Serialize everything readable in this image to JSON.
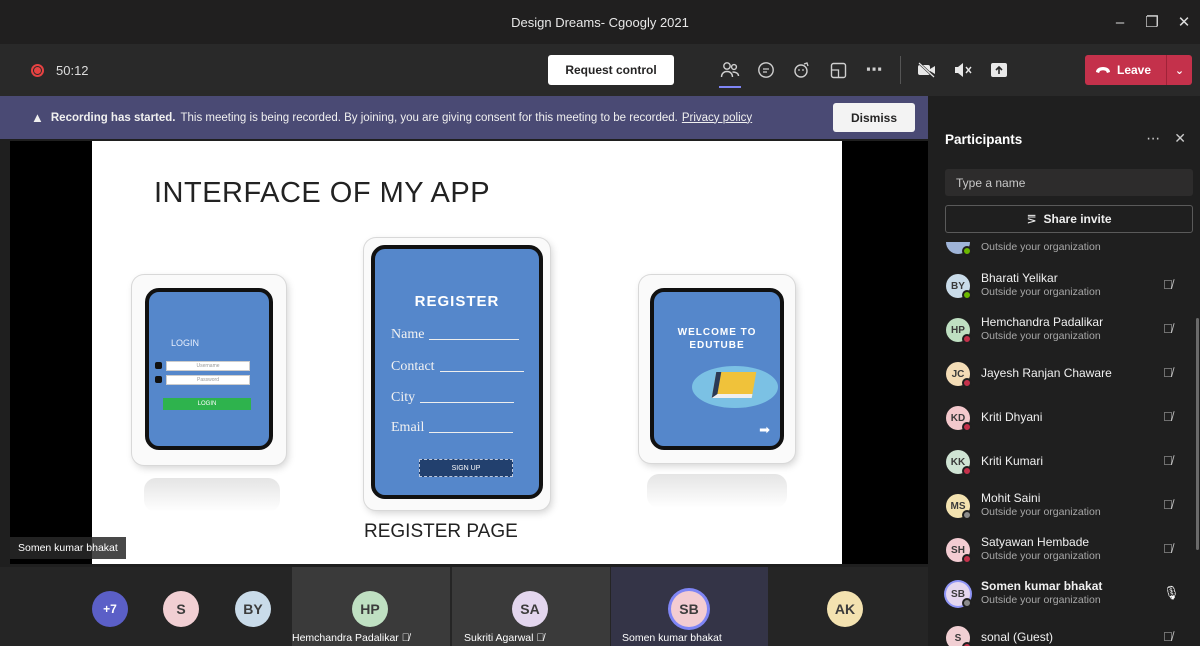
{
  "window": {
    "title": "Design Dreams- Cgoogly 2021"
  },
  "toolbar": {
    "timer": "50:12",
    "request_control": "Request control",
    "leave_label": "Leave"
  },
  "banner": {
    "bold": "Recording has started.",
    "text": "This meeting is being recorded. By joining, you are giving consent for this meeting to be recorded.",
    "link": "Privacy policy",
    "dismiss": "Dismiss"
  },
  "slide": {
    "title": "INTERFACE  OF MY APP",
    "login_title": "LOGIN",
    "username_ph": "Username",
    "password_ph": "Password",
    "login_button": "LOGIN",
    "register_title": "REGISTER",
    "fields": [
      "Name",
      "Contact",
      "City",
      "Email"
    ],
    "signup_button": "SIGN UP",
    "welcome_line1": "WELCOME TO",
    "welcome_line2": "EDUTUBE",
    "register_caption": "REGISTER PAGE"
  },
  "presenter_name": "Somen kumar bhakat",
  "participants_panel": {
    "title": "Participants",
    "search_placeholder": "Type a name",
    "share_invite": "Share invite",
    "list": [
      {
        "initials": "",
        "name": "",
        "org": "Outside your organization",
        "color": "#9fb4d8"
      },
      {
        "initials": "BY",
        "name": "Bharati Yelikar",
        "org": "Outside your organization",
        "color": "#c9dbe9"
      },
      {
        "initials": "HP",
        "name": "Hemchandra Padalikar",
        "org": "Outside your organization",
        "color": "#bfe0c2"
      },
      {
        "initials": "JC",
        "name": "Jayesh Ranjan Chaware",
        "org": "",
        "color": "#f3dcb6"
      },
      {
        "initials": "KD",
        "name": "Kriti Dhyani",
        "org": "",
        "color": "#f3c8cc"
      },
      {
        "initials": "KK",
        "name": "Kriti Kumari",
        "org": "",
        "color": "#cfe4d4"
      },
      {
        "initials": "MS",
        "name": "Mohit Saini",
        "org": "Outside your organization",
        "color": "#f3e2b0"
      },
      {
        "initials": "SH",
        "name": "Satyawan Hembade",
        "org": "Outside your organization",
        "color": "#f3ccd2"
      },
      {
        "initials": "SB",
        "name": "Somen kumar bhakat",
        "org": "Outside your organization",
        "color": "#e5d7ef"
      },
      {
        "initials": "S",
        "name": "sonal (Guest)",
        "org": "",
        "color": "#f1cfd3"
      }
    ]
  },
  "strip": [
    {
      "initials": "+7",
      "label": "",
      "color": "#5b5fc7"
    },
    {
      "initials": "S",
      "label": "",
      "color": "#f1cfd3"
    },
    {
      "initials": "BY",
      "label": "",
      "color": "#c9dbe9"
    },
    {
      "initials": "HP",
      "label": "Hemchandra Padalikar",
      "color": "#bfe0c2"
    },
    {
      "initials": "SA",
      "label": "Sukriti Agarwal",
      "color": "#e3d6ee"
    },
    {
      "initials": "SB",
      "label": "Somen kumar bhakat",
      "color": "#f3ccd2"
    },
    {
      "initials": "AK",
      "label": "",
      "color": "#f3e2b0"
    }
  ]
}
